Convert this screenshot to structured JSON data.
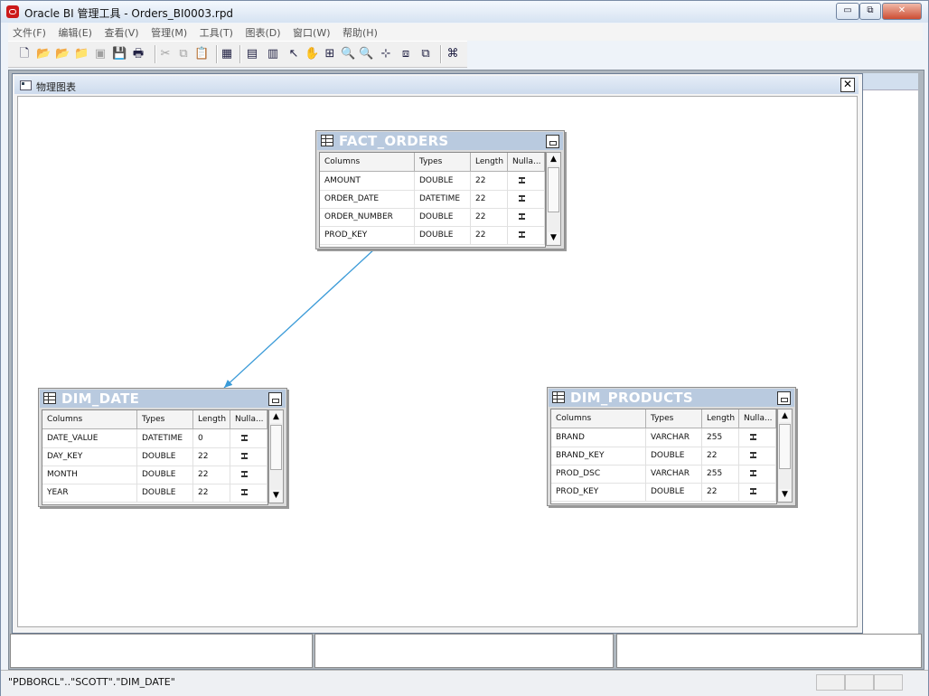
{
  "window": {
    "title": "Oracle BI 管理工具 - Orders_BI0003.rpd",
    "controls": {
      "minimize": "▭",
      "restore": "⧉",
      "close": "✕"
    }
  },
  "menu": [
    "文件(F)",
    "编辑(E)",
    "查看(V)",
    "管理(M)",
    "工具(T)",
    "图表(D)",
    "窗口(W)",
    "帮助(H)"
  ],
  "toolbar": {
    "icons": [
      {
        "name": "new-icon",
        "glyph": "🗋",
        "enabled": true
      },
      {
        "name": "open-icon",
        "glyph": "📂",
        "enabled": true
      },
      {
        "name": "open-online-icon",
        "glyph": "📂",
        "enabled": true
      },
      {
        "name": "open-cache-icon",
        "glyph": "📁",
        "enabled": true
      },
      {
        "name": "close-file-icon",
        "glyph": "▣",
        "enabled": false
      },
      {
        "name": "save-icon",
        "glyph": "💾",
        "enabled": true
      },
      {
        "name": "print-icon",
        "glyph": "🖶",
        "enabled": true
      },
      {
        "name": "cut-icon",
        "glyph": "✂",
        "enabled": false
      },
      {
        "name": "copy-icon",
        "glyph": "⧉",
        "enabled": false
      },
      {
        "name": "paste-icon",
        "glyph": "📋",
        "enabled": false
      },
      {
        "name": "diagram-view-icon",
        "glyph": "▦",
        "enabled": true
      },
      {
        "name": "new-table-icon",
        "glyph": "▤",
        "enabled": true
      },
      {
        "name": "new-join-icon",
        "glyph": "▥",
        "enabled": true
      },
      {
        "name": "select-pointer-icon",
        "glyph": "↖",
        "enabled": true
      },
      {
        "name": "pan-hand-icon",
        "glyph": "✋",
        "enabled": true
      },
      {
        "name": "zoom-fit-icon",
        "glyph": "⊞",
        "enabled": true
      },
      {
        "name": "zoom-in-icon",
        "glyph": "🔍",
        "enabled": true
      },
      {
        "name": "zoom-out-icon",
        "glyph": "🔍",
        "enabled": true
      },
      {
        "name": "grid-snap-icon",
        "glyph": "⊹",
        "enabled": true
      },
      {
        "name": "collapse-icon",
        "glyph": "⧈",
        "enabled": true
      },
      {
        "name": "expand-icon",
        "glyph": "⧉",
        "enabled": true
      },
      {
        "name": "auto-layout-icon",
        "glyph": "⌘",
        "enabled": true
      }
    ]
  },
  "diagram": {
    "title": "物理图表",
    "close_glyph": "✕",
    "column_headers": [
      "Columns",
      "Types",
      "Length",
      "Nulla..."
    ],
    "scroll_up": "▲",
    "scroll_down": "▼",
    "tables": [
      {
        "name": "FACT_ORDERS",
        "rows": [
          [
            "AMOUNT",
            "DOUBLE",
            "22"
          ],
          [
            "ORDER_DATE",
            "DATETIME",
            "22"
          ],
          [
            "ORDER_NUMBER",
            "DOUBLE",
            "22"
          ],
          [
            "PROD_KEY",
            "DOUBLE",
            "22"
          ]
        ]
      },
      {
        "name": "DIM_DATE",
        "rows": [
          [
            "DATE_VALUE",
            "DATETIME",
            "0"
          ],
          [
            "DAY_KEY",
            "DOUBLE",
            "22"
          ],
          [
            "MONTH",
            "DOUBLE",
            "22"
          ],
          [
            "YEAR",
            "DOUBLE",
            "22"
          ]
        ]
      },
      {
        "name": "DIM_PRODUCTS",
        "rows": [
          [
            "BRAND",
            "VARCHAR",
            "255"
          ],
          [
            "BRAND_KEY",
            "DOUBLE",
            "22"
          ],
          [
            "PROD_DSC",
            "VARCHAR",
            "255"
          ],
          [
            "PROD_KEY",
            "DOUBLE",
            "22"
          ]
        ]
      }
    ],
    "join": {
      "from": "FACT_ORDERS",
      "to": "DIM_DATE",
      "color": "#3b9bd8"
    }
  },
  "status": {
    "text": "\"PDBORCL\"..\"SCOTT\".\"DIM_DATE\""
  }
}
